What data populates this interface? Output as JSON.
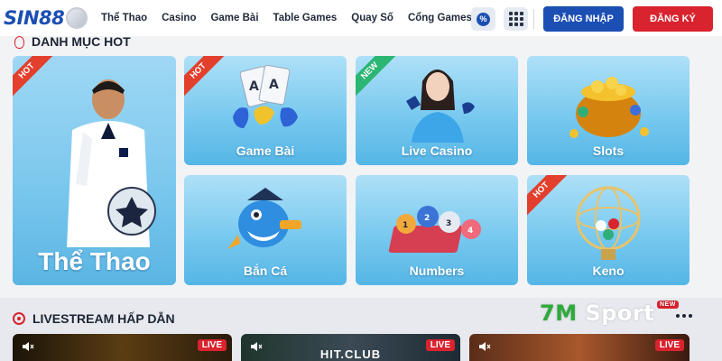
{
  "header": {
    "logo_text": "SIN88",
    "nav": [
      "Thể Thao",
      "Casino",
      "Game Bài",
      "Table Games",
      "Quay Số",
      "Cổng Games"
    ],
    "promo_symbol": "%",
    "login_label": "ĐĂNG NHẬP",
    "register_label": "ĐĂNG KÝ"
  },
  "categories": {
    "title": "DANH MỤC HOT",
    "tiles": [
      {
        "label": "Thể Thao",
        "badge": "HOT"
      },
      {
        "label": "Game Bài",
        "badge": "HOT"
      },
      {
        "label": "Live Casino",
        "badge": "NEW"
      },
      {
        "label": "Slots",
        "badge": ""
      },
      {
        "label": "Bắn Cá",
        "badge": ""
      },
      {
        "label": "Numbers",
        "badge": ""
      },
      {
        "label": "Keno",
        "badge": "HOT"
      }
    ]
  },
  "livestream": {
    "title": "LIVESTREAM HẤP DẪN",
    "brand": {
      "seven": "7M",
      "rest": " Sport",
      "badge": "NEW"
    },
    "streams": [
      {
        "live": "LIVE",
        "title": ""
      },
      {
        "live": "LIVE",
        "title": "HIT.CLUB"
      },
      {
        "live": "LIVE",
        "title": ""
      }
    ]
  },
  "colors": {
    "brand_blue": "#1c4fb3",
    "brand_red": "#d9232e",
    "tile_blue": "#74c7ee",
    "hot_badge": "#e2402d",
    "new_badge": "#2bb673"
  }
}
